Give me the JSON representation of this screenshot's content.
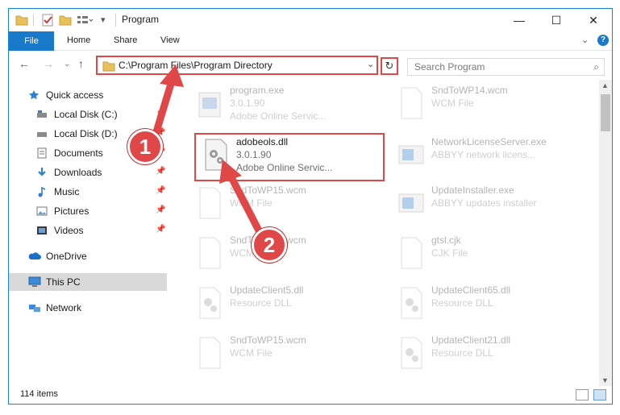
{
  "window": {
    "title": "Program",
    "minimize": "—",
    "maximize": "☐",
    "close": "✕"
  },
  "ribbon": {
    "tabs": [
      "File",
      "Home",
      "Share",
      "View"
    ]
  },
  "address": {
    "path": "C:\\Program Files\\Program Directory",
    "search_placeholder": "Search Program"
  },
  "sidebar": {
    "items": [
      {
        "label": "Quick access",
        "icon": "star-icon"
      },
      {
        "label": "Local Disk (C:)",
        "icon": "drive-icon"
      },
      {
        "label": "Local Disk (D:)",
        "icon": "drive-icon"
      },
      {
        "label": "Documents",
        "icon": "documents-icon"
      },
      {
        "label": "Downloads",
        "icon": "download-icon"
      },
      {
        "label": "Music",
        "icon": "music-icon"
      },
      {
        "label": "Pictures",
        "icon": "pictures-icon"
      },
      {
        "label": "Videos",
        "icon": "videos-icon"
      },
      {
        "label": "OneDrive",
        "icon": "cloud-icon"
      },
      {
        "label": "This PC",
        "icon": "computer-icon"
      },
      {
        "label": "Network",
        "icon": "network-icon"
      }
    ]
  },
  "files": [
    {
      "name": "program.exe",
      "line2": "3.0.1.90",
      "line3": "Adobe Online Servic...",
      "icon": "exe-icon"
    },
    {
      "name": "SndToWP14.wcm",
      "line2": "WCM File",
      "line3": "",
      "icon": "file-icon"
    },
    {
      "name": "adobeols.dll",
      "line2": "3.0.1.90",
      "line3": "Adobe Online Servic...",
      "icon": "dll-icon"
    },
    {
      "name": "NetworkLicenseServer.exe",
      "line2": "ABBYY network licens...",
      "line3": "",
      "icon": "app-icon"
    },
    {
      "name": "SndToWP15.wcm",
      "line2": "WCM File",
      "line3": "",
      "icon": "file-icon"
    },
    {
      "name": "UpdateInstaller.exe",
      "line2": "ABBYY updates installer",
      "line3": "",
      "icon": "app-icon"
    },
    {
      "name": "SndToWP20.wcm",
      "line2": "WCM File",
      "line3": "",
      "icon": "file-icon"
    },
    {
      "name": "gtsl.cjk",
      "line2": "CJK File",
      "line3": "",
      "icon": "file-icon"
    },
    {
      "name": "UpdateClient5.dll",
      "line2": "Resource DLL",
      "line3": "",
      "icon": "dll-icon"
    },
    {
      "name": "UpdateClient65.dll",
      "line2": "Resource DLL",
      "line3": "",
      "icon": "dll-icon"
    },
    {
      "name": "SndToWP15.wcm",
      "line2": "WCM File",
      "line3": "",
      "icon": "file-icon"
    },
    {
      "name": "UpdateClient21.dll",
      "line2": "Resource DLL",
      "line3": "",
      "icon": "dll-icon"
    }
  ],
  "status": {
    "items_count": "114 items"
  },
  "annotations": {
    "step1": "1",
    "step2": "2",
    "color": "#e04848"
  }
}
